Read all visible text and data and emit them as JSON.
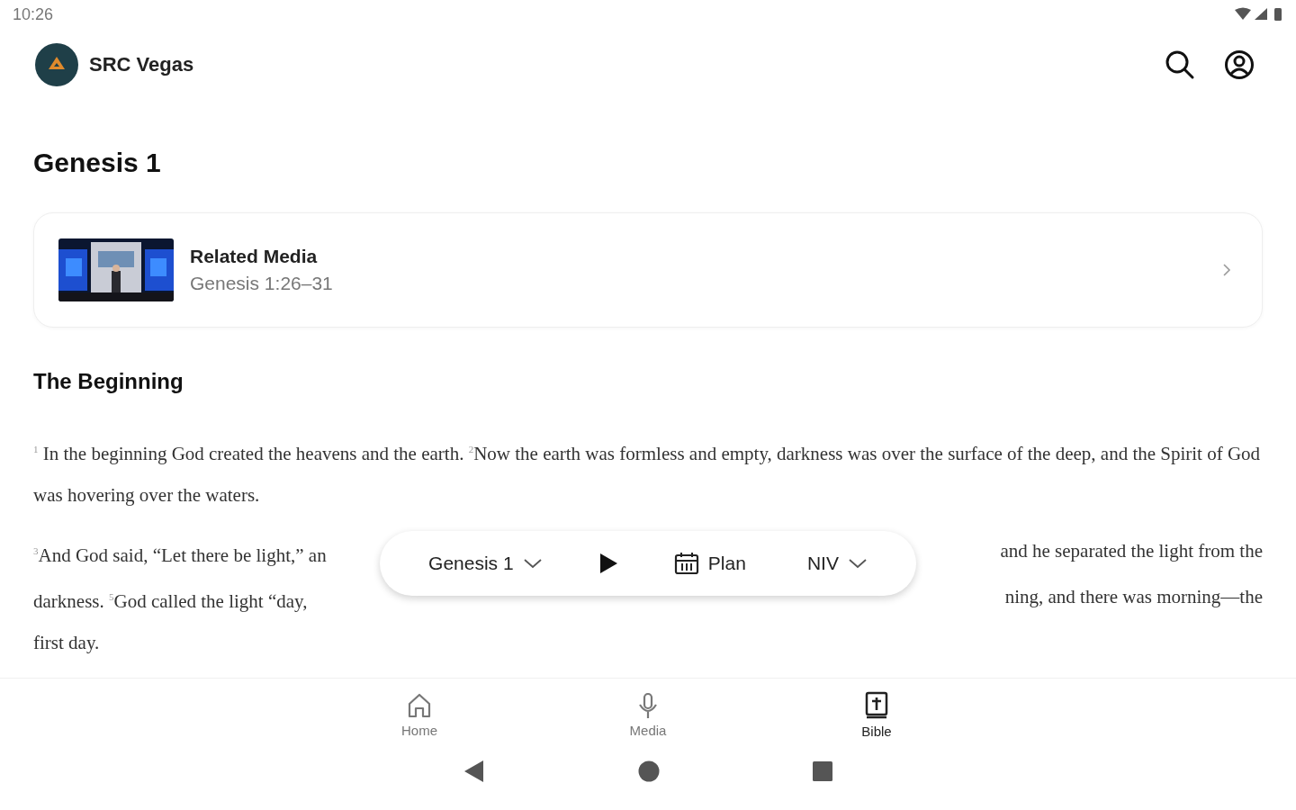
{
  "status_bar": {
    "time": "10:26"
  },
  "header": {
    "title": "SRC Vegas"
  },
  "page_title": "Genesis 1",
  "related_media": {
    "title": "Related Media",
    "subtitle": "Genesis 1:26–31"
  },
  "section_heading": "The Beginning",
  "paragraphs": [
    {
      "lines": [
        {
          "left": "$^{1}$ In the beginning God created the heavens and the earth. $^{2}$Now the earth was formless and empty, darkness was over the surface of the deep, and the Spirit of God was hovering over the waters."
        }
      ]
    },
    {
      "lines": [
        {
          "left": "$^{3}$And God said, “Let there be light,” an",
          "right": "and he separated the light from the"
        },
        {
          "left": "darkness. $^{5}$God called the light “day,",
          "right": "ning, and there was morning—the"
        },
        {
          "left": "first day."
        }
      ]
    }
  ],
  "player_bar": {
    "chapter": "Genesis 1",
    "plan": "Plan",
    "version": "NIV"
  },
  "bottom_nav": [
    {
      "label": "Home",
      "kind": "home",
      "selected": false
    },
    {
      "label": "Media",
      "kind": "media",
      "selected": false
    },
    {
      "label": "Bible",
      "kind": "bible",
      "selected": true
    }
  ]
}
